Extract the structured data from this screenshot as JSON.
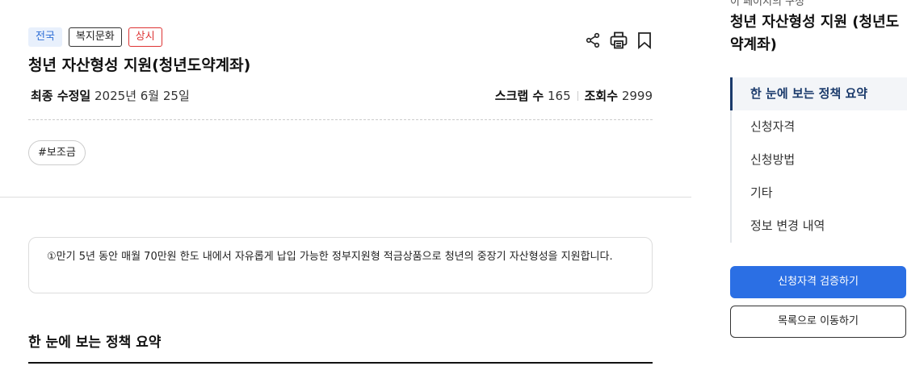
{
  "policy": {
    "tags": {
      "region": "전국",
      "category": "복지문화",
      "status": "상시"
    },
    "title": "청년 자산형성 지원(청년도약계좌)",
    "meta": {
      "updated_label": "최종 수정일",
      "updated_value": "2025년 6월 25일",
      "scrap_label": "스크랩 수",
      "scrap_value": "165",
      "views_label": "조회수",
      "views_value": "2999"
    },
    "hashtag": "#보조금",
    "summary": "①만기 5년 동안 매월 70만원 한도 내에서 자유롭게 납입 가능한 정부지원형 적금상품으로 청년의 중장기 자산형성을 지원합니다.",
    "section_title": "한 눈에 보는 정책 요약"
  },
  "actions": {
    "share_icon": "share-icon",
    "print_icon": "print-icon",
    "bookmark_icon": "bookmark-icon"
  },
  "sidebar": {
    "cut_text": "이 페이지의 구성",
    "title": "청년 자산형성 지원 (청년도약계좌)",
    "toc": [
      {
        "label": "한 눈에 보는 정책 요약",
        "active": true
      },
      {
        "label": "신청자격",
        "active": false
      },
      {
        "label": "신청방법",
        "active": false
      },
      {
        "label": "기타",
        "active": false
      },
      {
        "label": "정보 변경 내역",
        "active": false
      }
    ],
    "primary_button": "신청자격 검증하기",
    "secondary_button": "목록으로 이동하기"
  },
  "colors": {
    "primary": "#2b6fe4",
    "active_nav": "#1a3a6b",
    "status_tag": "#dd3333",
    "region_tag_bg": "#e8f0fc"
  }
}
